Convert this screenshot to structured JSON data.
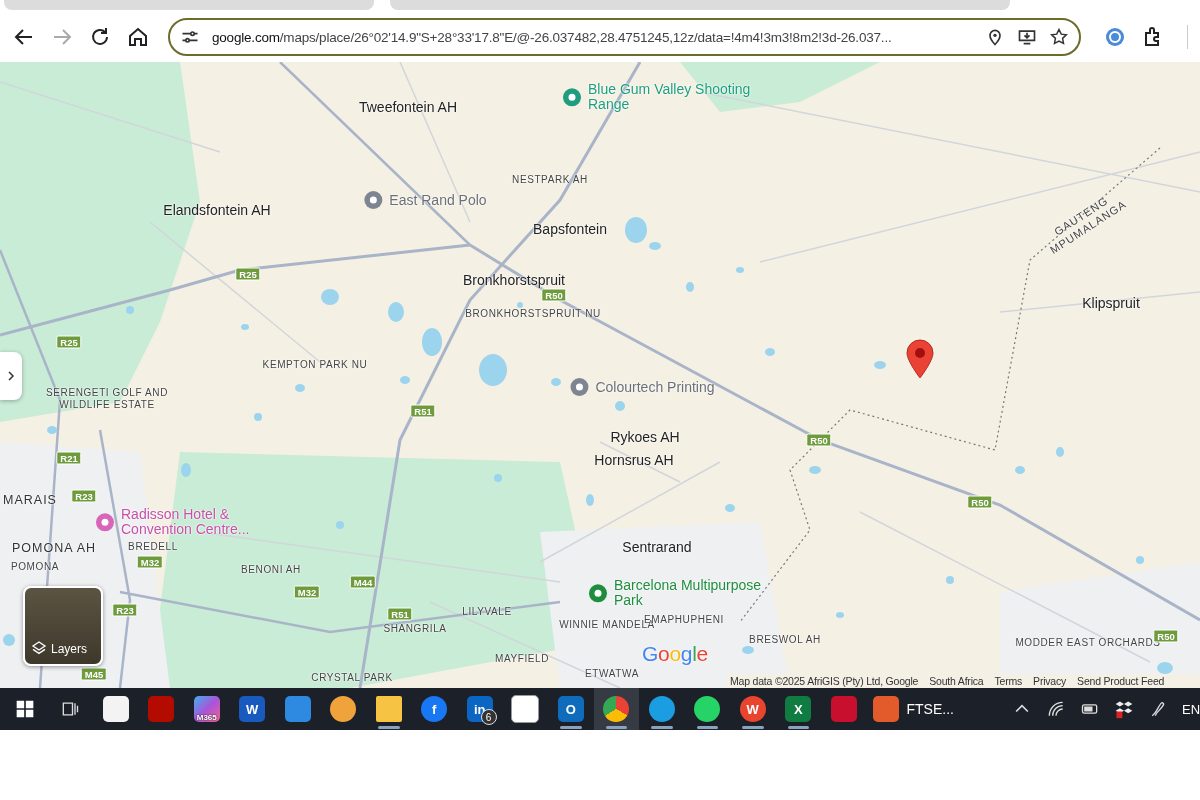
{
  "browser": {
    "forward_disabled": true,
    "url_host": "google.com",
    "url_path": "/maps/place/26°02'14.9\"S+28°33'17.8\"E/@-26.037482,28.4751245,12z/data=!4m4!3m3!8m2!3d-26.037..."
  },
  "map": {
    "labels": [
      {
        "kind": "place",
        "text": "Tweefontein AH"
      },
      {
        "kind": "poi_park",
        "text": "Blue Gum Valley Shooting Range"
      },
      {
        "kind": "suburb",
        "text": "NESTPARK AH"
      },
      {
        "kind": "place",
        "text": "Elandsfontein AH"
      },
      {
        "kind": "poi",
        "text": "East Rand Polo"
      },
      {
        "kind": "place",
        "text": "Bapsfontein"
      },
      {
        "kind": "boundary",
        "text": "GAUTENG MPUMALANGA"
      },
      {
        "kind": "road",
        "text": "R25"
      },
      {
        "kind": "place",
        "text": "Bronkhorstspruit"
      },
      {
        "kind": "road",
        "text": "R50"
      },
      {
        "kind": "place",
        "text": "Klipspruit"
      },
      {
        "kind": "suburb",
        "text": "BRONKHORSTSPRUIT NU"
      },
      {
        "kind": "road",
        "text": "R25"
      },
      {
        "kind": "suburb",
        "text": "KEMPTON PARK NU"
      },
      {
        "kind": "suburb",
        "text": "SERENGETI GOLF AND WILDLIFE ESTATE"
      },
      {
        "kind": "poi",
        "text": "Colourtech Printing"
      },
      {
        "kind": "road",
        "text": "R51"
      },
      {
        "kind": "place",
        "text": "Rykoes AH"
      },
      {
        "kind": "road",
        "text": "R50"
      },
      {
        "kind": "road",
        "text": "R21"
      },
      {
        "kind": "place",
        "text": "Hornsrus AH"
      },
      {
        "kind": "area",
        "text": "MARAIS"
      },
      {
        "kind": "road",
        "text": "R23"
      },
      {
        "kind": "road",
        "text": "R50"
      },
      {
        "kind": "poi_hotel",
        "text": "Radisson Hotel & Convention Centre..."
      },
      {
        "kind": "area",
        "text": "POMONA AH"
      },
      {
        "kind": "suburb",
        "text": "BREDELL"
      },
      {
        "kind": "place",
        "text": "Sentrarand"
      },
      {
        "kind": "suburb",
        "text": "POMONA"
      },
      {
        "kind": "road",
        "text": "M32"
      },
      {
        "kind": "suburb",
        "text": "BENONI AH"
      },
      {
        "kind": "road",
        "text": "M32"
      },
      {
        "kind": "road",
        "text": "M44"
      },
      {
        "kind": "poi_green",
        "text": "Barcelona Multipurpose Park"
      },
      {
        "kind": "road",
        "text": "R23"
      },
      {
        "kind": "road",
        "text": "R51"
      },
      {
        "kind": "suburb",
        "text": "LILYVALE"
      },
      {
        "kind": "suburb",
        "text": "SHANGRILA"
      },
      {
        "kind": "suburb",
        "text": "WINNIE MANDELA"
      },
      {
        "kind": "suburb",
        "text": "EMAPHUPHENI"
      },
      {
        "kind": "suburb",
        "text": "BRESWOL AH"
      },
      {
        "kind": "suburb",
        "text": "MODDER EAST ORCHARDS"
      },
      {
        "kind": "road",
        "text": "R50"
      },
      {
        "kind": "suburb",
        "text": "MAYFIELD"
      },
      {
        "kind": "road",
        "text": "M45"
      },
      {
        "kind": "suburb",
        "text": "CRYSTAL PARK"
      },
      {
        "kind": "suburb",
        "text": "ETWATWA"
      }
    ],
    "layers_button": "Layers",
    "logo": "Google",
    "attribution": [
      "Map data ©2025 AfriGIS (Pty) Ltd, Google",
      "South Africa",
      "Terms",
      "Privacy",
      "Send Product Feed"
    ]
  },
  "taskbar": {
    "items": [
      {
        "kind": "start",
        "running": false,
        "selected": false
      },
      {
        "kind": "taskview",
        "running": false,
        "selected": false
      },
      {
        "kind": "store",
        "running": false,
        "selected": false
      },
      {
        "kind": "acrobat",
        "running": false,
        "selected": false
      },
      {
        "kind": "copilot",
        "label": "M365",
        "running": false,
        "selected": false
      },
      {
        "kind": "word",
        "label": "W",
        "running": false,
        "selected": false
      },
      {
        "kind": "calendar",
        "running": false,
        "selected": false
      },
      {
        "kind": "sphere",
        "running": false,
        "selected": false
      },
      {
        "kind": "explorer",
        "running": true,
        "selected": false
      },
      {
        "kind": "facebook",
        "label": "f",
        "running": false,
        "selected": false
      },
      {
        "kind": "linkedin",
        "label": "in",
        "badge": "6",
        "running": false,
        "selected": false
      },
      {
        "kind": "triangle",
        "running": false,
        "selected": false
      },
      {
        "kind": "outlook",
        "label": "O",
        "running": true,
        "selected": false
      },
      {
        "kind": "chrome",
        "running": true,
        "selected": true
      },
      {
        "kind": "edge",
        "running": true,
        "selected": false
      },
      {
        "kind": "whatsapp",
        "running": true,
        "selected": false
      },
      {
        "kind": "wps",
        "label": "W",
        "running": true,
        "selected": false
      },
      {
        "kind": "excel",
        "label": "X",
        "running": true,
        "selected": false
      },
      {
        "kind": "mcafee",
        "running": false,
        "selected": false
      },
      {
        "kind": "ftse",
        "label": "FTSE...",
        "running": false,
        "selected": false
      }
    ],
    "language": "EN"
  }
}
